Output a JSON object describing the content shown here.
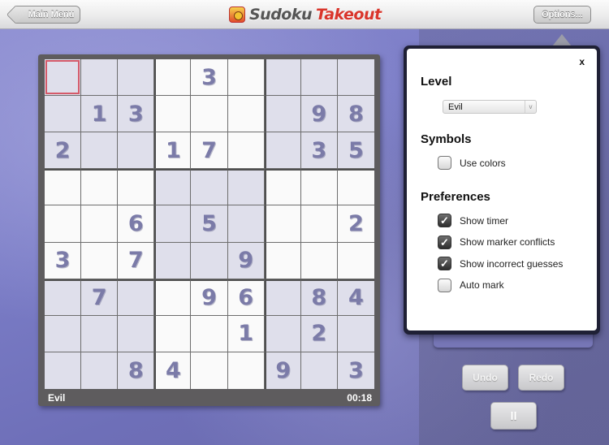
{
  "topbar": {
    "back_label": "Main Menu",
    "logo_part1": "Sudoku",
    "logo_part2": "Takeout",
    "options_label": "Options..."
  },
  "board": {
    "rows": [
      [
        "",
        "",
        "",
        "",
        "3",
        "",
        "",
        "",
        ""
      ],
      [
        "",
        "1",
        "3",
        "",
        "",
        "",
        "",
        "9",
        "8"
      ],
      [
        "2",
        "",
        "",
        "1",
        "7",
        "",
        "",
        "3",
        "5"
      ],
      [
        "",
        "",
        "",
        "",
        "",
        "",
        "",
        "",
        ""
      ],
      [
        "",
        "",
        "6",
        "",
        "5",
        "",
        "",
        "",
        "2"
      ],
      [
        "3",
        "",
        "7",
        "",
        "",
        "9",
        "",
        "",
        ""
      ],
      [
        "",
        "7",
        "",
        "",
        "9",
        "6",
        "",
        "8",
        "4"
      ],
      [
        "",
        "",
        "",
        "",
        "",
        "1",
        "",
        "2",
        ""
      ],
      [
        "",
        "",
        "8",
        "4",
        "",
        "",
        "9",
        "",
        "3"
      ]
    ],
    "selected_cell": {
      "row": 0,
      "col": 0
    },
    "level": "Evil",
    "timer": "00:18"
  },
  "controls": {
    "undo_label": "Undo",
    "redo_label": "Redo",
    "pause_label": "II"
  },
  "options": {
    "close_label": "x",
    "level_title": "Level",
    "level_value": "Evil",
    "level_chevron": "v",
    "symbols_title": "Symbols",
    "symbols": [
      {
        "label": "Use colors",
        "checked": false
      }
    ],
    "preferences_title": "Preferences",
    "preferences": [
      {
        "label": "Show timer",
        "checked": true
      },
      {
        "label": "Show marker conflicts",
        "checked": true
      },
      {
        "label": "Show incorrect guesses",
        "checked": true
      },
      {
        "label": "Auto mark",
        "checked": false
      }
    ],
    "check_glyph": "✓"
  },
  "colors": {
    "digit": "#7b7ba8",
    "selected_border": "#d55a6a",
    "logo_red": "#d9352b"
  }
}
